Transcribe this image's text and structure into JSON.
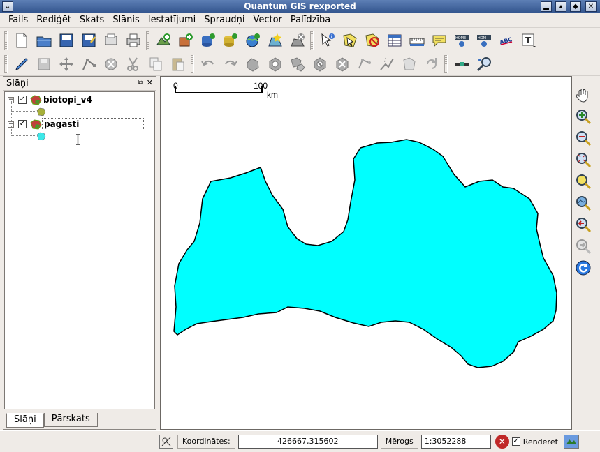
{
  "window": {
    "title": "Quantum GIS rexported"
  },
  "menubar": {
    "items": [
      "Fails",
      "Rediģēt",
      "Skats",
      "Slānis",
      "Iestatījumi",
      "Spraudņi",
      "Vector",
      "Palīdzība"
    ]
  },
  "layers_panel": {
    "title": "Slāņi",
    "layers": [
      {
        "name": "biotopi_v4",
        "checked": "✓",
        "expander": "−",
        "color": "#a6b03a"
      },
      {
        "name": "pagasti",
        "checked": "✓",
        "expander": "−",
        "color": "#3de8e8"
      }
    ],
    "tabs": [
      "Slāņi",
      "Pārskats"
    ]
  },
  "map": {
    "scale_bar": {
      "zero": "0",
      "hundred": "100",
      "unit": "km"
    },
    "fill_color": "#00ffff"
  },
  "statusbar": {
    "coords_label": "Koordinātes:",
    "coords_value": "426667,315602",
    "scale_label": "Mērogs",
    "scale_value": "1:3052288",
    "render_label": "Renderēt",
    "render_checked": "✓"
  }
}
